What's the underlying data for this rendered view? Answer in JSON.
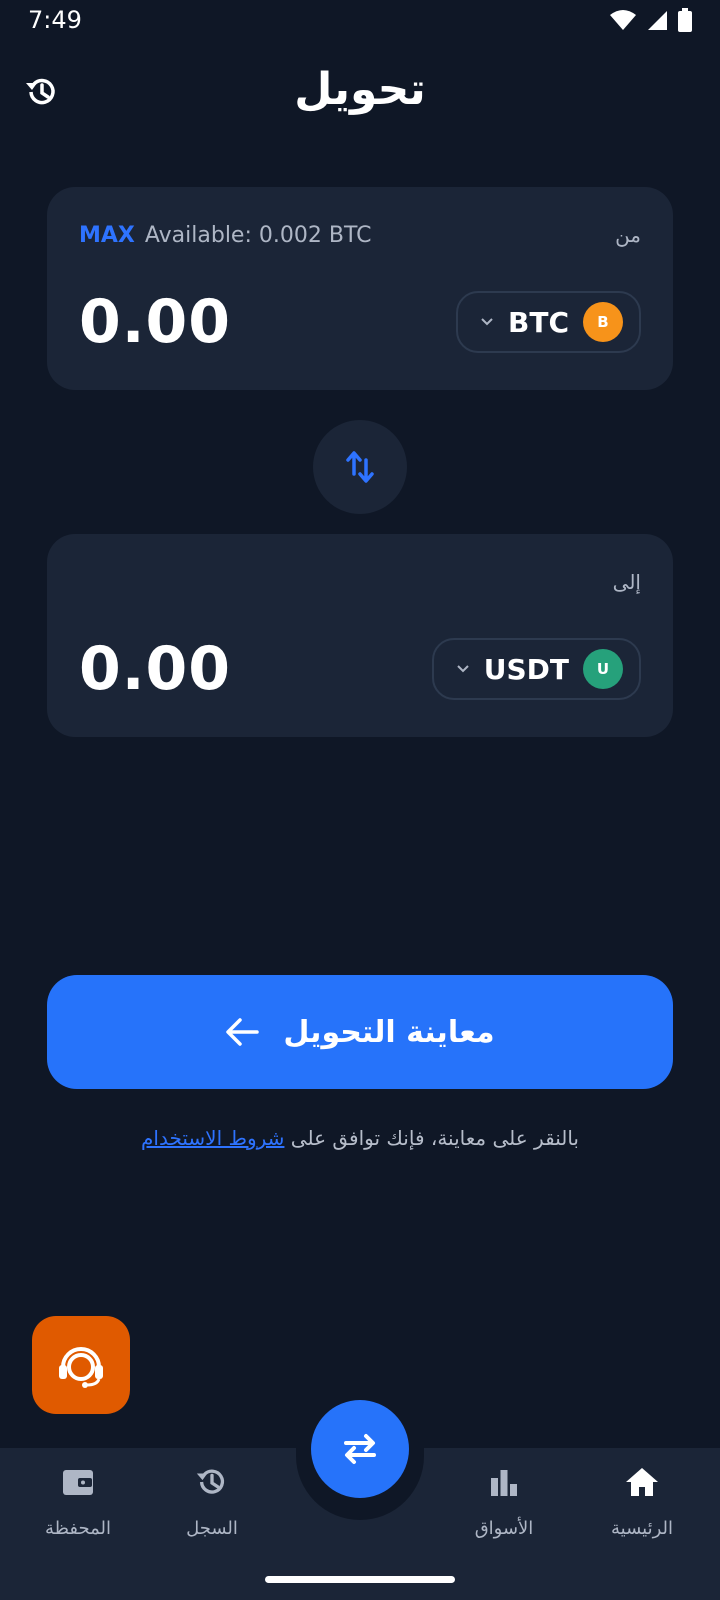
{
  "status_bar": {
    "time": "7:49"
  },
  "header": {
    "title": "تحويل"
  },
  "from_card": {
    "label": "من",
    "max_label": "MAX",
    "available": "Available: 0.002 BTC",
    "amount": "0.00",
    "coin": {
      "symbol": "BTC",
      "badge": "B",
      "color": "#f7931a"
    }
  },
  "to_card": {
    "label": "إلى",
    "amount": "0.00",
    "coin": {
      "symbol": "USDT",
      "badge": "U",
      "color": "#26a17b"
    }
  },
  "preview_button": {
    "label": "معاينة التحويل"
  },
  "terms": {
    "text": "بالنقر على معاينة، فإنك توافق على ",
    "link": "شروط الاستخدام"
  },
  "bottom_nav": {
    "wallet": "المحفظة",
    "history": "السجل",
    "markets": "الأسواق",
    "home": "الرئيسية"
  },
  "colors": {
    "accent": "#2673fa",
    "background": "#0f1726",
    "card": "#1b2537",
    "support": "#e05a00"
  }
}
